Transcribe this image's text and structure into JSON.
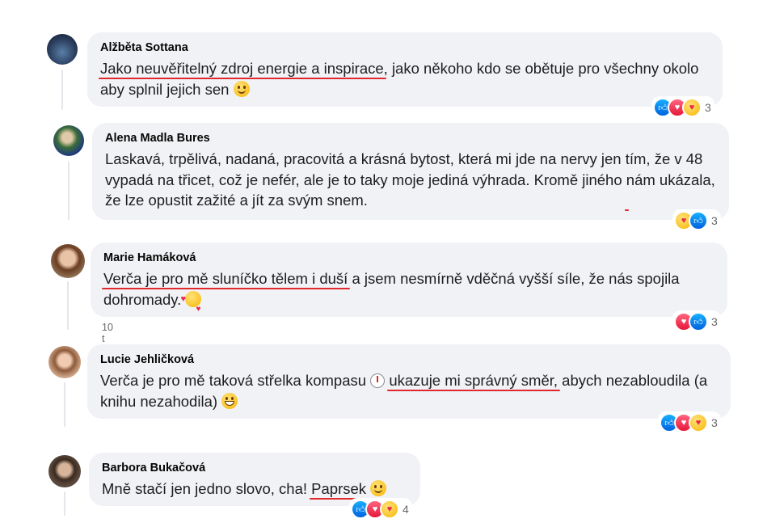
{
  "comments": [
    {
      "author": "Alžběta Sottana",
      "underlined": "Jako neuvěřitelný zdroj energie a inspirace",
      "text_after": ", jako někoho kdo se obětuje pro všechny okolo aby splnil jejich sen",
      "emoji": "slightly-smiling-face",
      "reaction_count": "3"
    },
    {
      "author": "Alena Madla Bures",
      "text_before": "Laskavá, trpělivá, nadaná, pracovitá a krásná bytost, která mi jde na nervy jen tím, že v 48 vypadá na třicet, což je nefér, ale je to taky moje jediná výhrada. Kromě jiného ",
      "underlined": "nám ukázala, že lze opustit zažité a jít za svým snem.",
      "reaction_count": "3"
    },
    {
      "author": "Marie Hamáková",
      "underlined": "Verča je pro mě sluníčko tělem i duší",
      "text_after": " a jsem nesmírně vděčná vyšší síle, že nás spojila dohromady.",
      "emoji": "smiling-face-with-hearts",
      "reaction_count": "3",
      "timestamp": "10 t"
    },
    {
      "author": "Lucie Jehličková",
      "text_before": "Verča je pro mě taková střelka kompasu ",
      "icon": "compass-icon",
      "underlined": "ukazuje mi správný směr,",
      "text_after": " abych nezabloudila (a knihu nezahodila)",
      "emoji": "grinning-face",
      "reaction_count": "3"
    },
    {
      "author": "Barbora Bukačová",
      "text_before": "Mně stačí jen jedno slovo, cha! ",
      "underlined": "Paprsek",
      "emoji": "slightly-smiling-face",
      "reaction_count": "4"
    }
  ],
  "colors": {
    "bubble": "#f0f2f5",
    "underline": "#e0292e",
    "like": "#1877f2",
    "love": "#f33e58"
  }
}
